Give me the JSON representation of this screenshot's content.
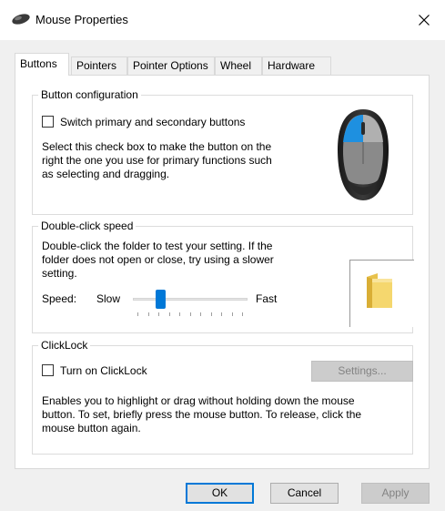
{
  "window": {
    "title": "Mouse Properties",
    "close_symbol": "×"
  },
  "tabs": [
    {
      "label": "Buttons",
      "active": true
    },
    {
      "label": "Pointers"
    },
    {
      "label": "Pointer Options"
    },
    {
      "label": "Wheel"
    },
    {
      "label": "Hardware"
    }
  ],
  "button_configuration": {
    "legend": "Button configuration",
    "checkbox_label": "Switch primary and secondary buttons",
    "checked": false,
    "description_lines": [
      "Select this check box to make the button on the",
      "right the one you use for primary functions such",
      "as selecting and dragging."
    ]
  },
  "double_click": {
    "legend": "Double-click speed",
    "description_lines": [
      "Double-click the folder to test your setting. If the",
      "folder does not open or close, try using a slower",
      "setting."
    ],
    "speed_label": "Speed:",
    "slow_label": "Slow",
    "fast_label": "Fast",
    "slider_value_fraction": 0.22
  },
  "clicklock": {
    "legend": "ClickLock",
    "checkbox_label": "Turn on ClickLock",
    "checked": false,
    "settings_button": "Settings...",
    "description_lines": [
      "Enables you to highlight or drag without holding down the mouse",
      "button. To set, briefly press the mouse button. To release, click the",
      "mouse button again."
    ]
  },
  "footer": {
    "ok": "OK",
    "cancel": "Cancel",
    "apply": "Apply"
  },
  "colors": {
    "accent": "#0078d7",
    "mouse_highlight": "#1e90e0",
    "folder": "#f5d76e"
  },
  "icons": {
    "title": "mouse-icon",
    "close": "close-icon",
    "preview": "mouse-illustration",
    "folder": "folder-icon"
  }
}
